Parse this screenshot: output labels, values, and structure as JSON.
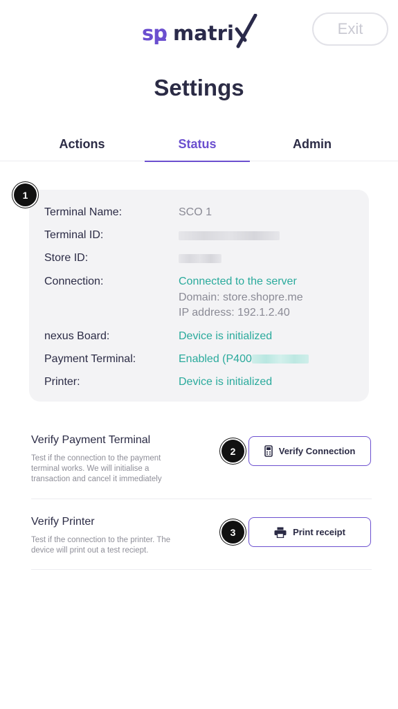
{
  "header": {
    "logo_sp": "sp",
    "logo_matrix": "matri",
    "exit_label": "Exit"
  },
  "page": {
    "title": "Settings"
  },
  "tabs": [
    {
      "label": "Actions",
      "active": false
    },
    {
      "label": "Status",
      "active": true
    },
    {
      "label": "Admin",
      "active": false
    }
  ],
  "markers": [
    "1",
    "2",
    "3"
  ],
  "status": {
    "terminal_name_label": "Terminal Name:",
    "terminal_name_value": "SCO 1",
    "terminal_id_label": "Terminal ID:",
    "store_id_label": "Store ID:",
    "connection_label": "Connection:",
    "connection_status": "Connected to the server",
    "connection_domain": "Domain: store.shopre.me",
    "connection_ip": "IP address: 192.1.2.40",
    "nexus_label": "nexus Board:",
    "nexus_value": "Device is initialized",
    "payment_label": "Payment Terminal:",
    "payment_value": "Enabled (P400",
    "printer_label": "Printer:",
    "printer_value": "Device is initialized"
  },
  "verify_payment": {
    "title": "Verify Payment Terminal",
    "desc_line1": "Test if the connection to the payment",
    "desc_line2": "terminal works. We will initialise a",
    "desc_line3": "transaction and cancel it immediately",
    "button_label": "Verify Connection",
    "button_icon": "card-terminal-icon"
  },
  "verify_printer": {
    "title": "Verify Printer",
    "desc_line1": "Test if the connection to the printer. The",
    "desc_line2": "device will print out a test reciept.",
    "button_label": "Print receipt",
    "button_icon": "printer-icon"
  },
  "colors": {
    "accent": "#6b4fcf",
    "teal": "#2aaa9c",
    "dark": "#2b2b45",
    "card_bg": "#f3f3f5"
  }
}
